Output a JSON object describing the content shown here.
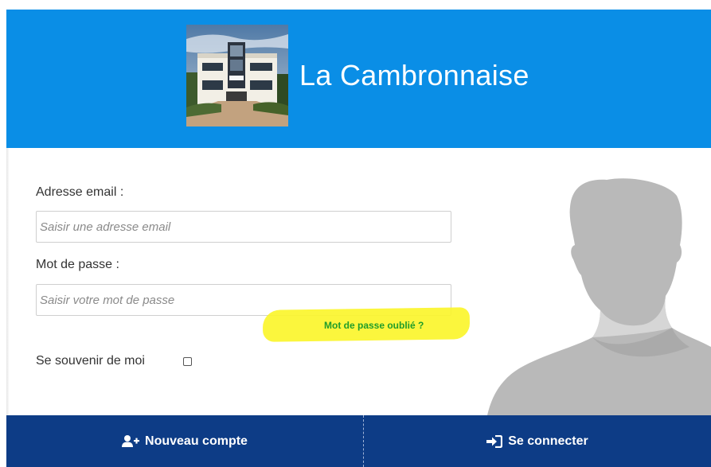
{
  "header": {
    "title": "La Cambronnaise",
    "brand_color": "#0a8ee6"
  },
  "form": {
    "email_label": "Adresse email :",
    "email_placeholder": "Saisir une adresse email",
    "email_value": "",
    "password_label": "Mot de passe :",
    "password_placeholder": "Saisir votre mot de passe",
    "password_value": "",
    "forgot_password": "Mot de passe oublié ?",
    "remember_me": "Se souvenir de moi",
    "remember_checked": false,
    "link_color": "#1f9d2a"
  },
  "footer": {
    "new_account_label": "Nouveau compte",
    "new_account_icon": "user-plus-icon",
    "login_label": "Se connecter",
    "login_icon": "sign-in-icon",
    "background_color": "#0d3c86"
  },
  "decor": {
    "logo_image": "building-photo",
    "avatar_image": "person-silhouette",
    "highlight_color": "#fbf52c"
  }
}
